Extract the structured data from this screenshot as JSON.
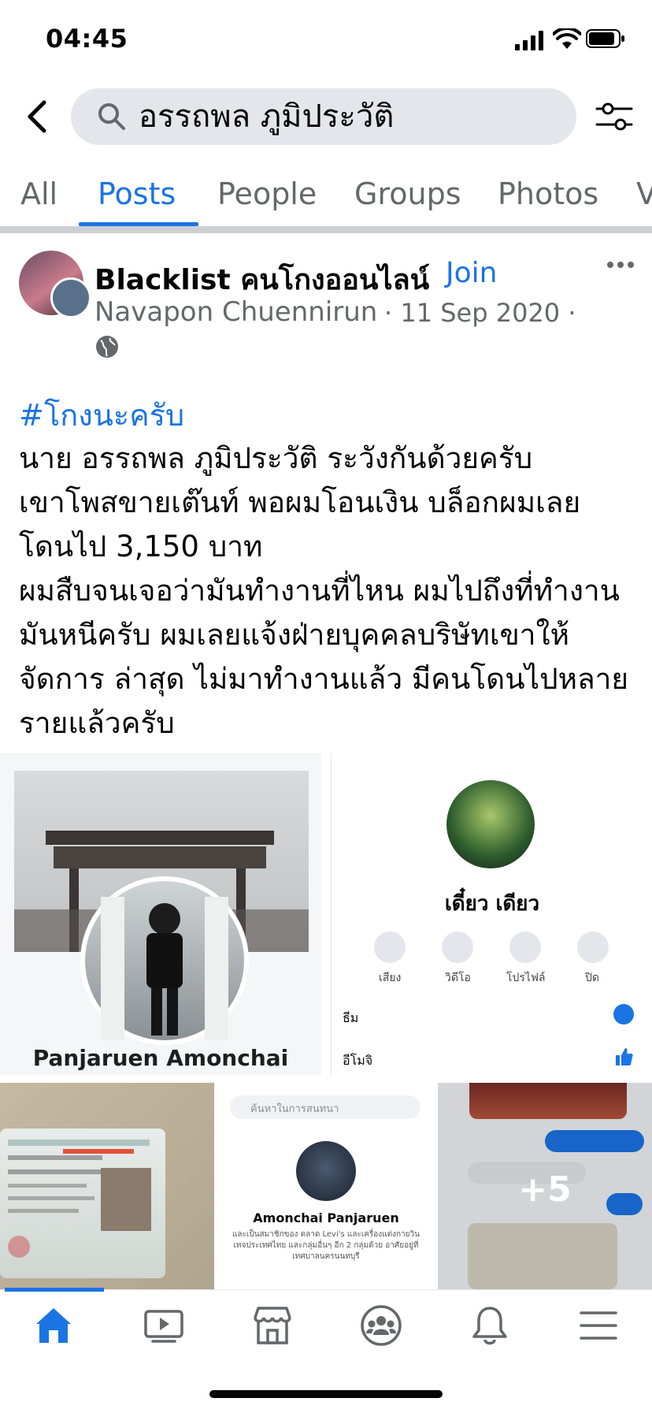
{
  "status_bar": {
    "time": "04:45"
  },
  "search": {
    "query": "อรรถพล ภูมิประวัติ"
  },
  "tabs": [
    {
      "label": "All",
      "active": false
    },
    {
      "label": "Posts",
      "active": true
    },
    {
      "label": "People",
      "active": false
    },
    {
      "label": "Groups",
      "active": false
    },
    {
      "label": "Photos",
      "active": false
    },
    {
      "label": "V",
      "active": false
    }
  ],
  "post": {
    "group_name": "Blacklist คนโกงออนไลน์",
    "separator": "·",
    "join_label": "Join",
    "author": "Navapon Chuennirun",
    "date": "· 11 Sep 2020 ·",
    "hashtag": "#โกงนะครับ",
    "lines": [
      "นาย อรรถพล ภูมิประวัติ ระวังกันด้วยครับ",
      "เขาโพสขายเต๊นท์ พอผมโอนเงิน บล็อกผมเลย",
      "โดนไป 3,150 บาท",
      "ผมสืบจนเจอว่ามันทำงานที่ไหน ผมไปถึงที่ทำงาน",
      "มันหนีครับ ผมเลยแจ้งฝ่ายบุคคลบริษัทเขาให้",
      "จัดการ ล่าสุด ไม่มาทำงานแล้ว มีคนโดนไปหลาย",
      "รายแล้วครับ"
    ],
    "photos": {
      "p1_name": "Panjaruen Amonchai",
      "p2_name": "เดี๋ยว เดียว",
      "p2_actions": [
        "เสียง",
        "วิดีโอ",
        "โปรไฟล์",
        "ปิด"
      ],
      "p2_theme": "ธีม",
      "p2_emoji": "อีโมจิ",
      "p4_search": "ค้นหาในการสนทนา",
      "p4_name": "Amonchai Panjaruen",
      "p4_desc": "และเป็นสมาชิกของ ตลาด Levi's และเครื่องแต่งกายวินเทจประเทศไทย และกลุ่มอื่นๆ อีก 2 กลุ่มด้วย อาศัยอยู่ที่ เทศบาลนครนนทบุรี",
      "more_count": "+5"
    }
  },
  "nav": {
    "items": [
      "home-icon",
      "watch-icon",
      "marketplace-icon",
      "groups-icon",
      "notifications-icon",
      "menu-icon"
    ],
    "active_color": "#1b74e4",
    "inactive_color": "#65676b"
  }
}
